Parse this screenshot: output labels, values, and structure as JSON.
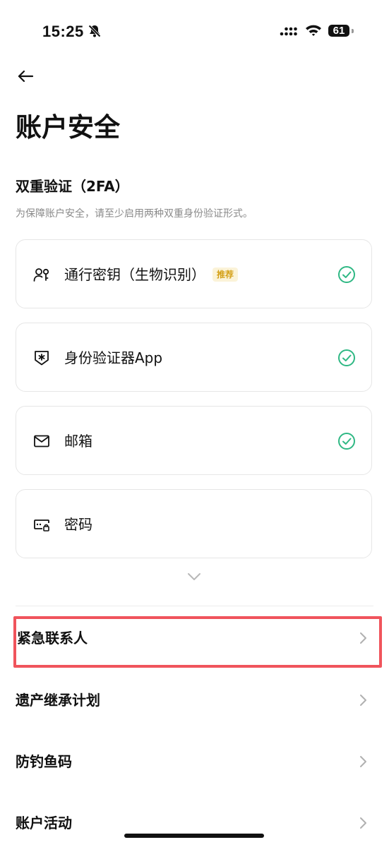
{
  "status_bar": {
    "time": "15:25",
    "battery": "61"
  },
  "page": {
    "title": "账户安全"
  },
  "two_fa": {
    "title": "双重验证（2FA）",
    "description": "为保障账户安全，请至少启用两种双重身份验证形式。",
    "methods": [
      {
        "label": "通行密钥（生物识别）",
        "tag": "推荐",
        "icon": "passkey-icon",
        "enabled": true
      },
      {
        "label": "身份验证器App",
        "icon": "authenticator-icon",
        "enabled": true
      },
      {
        "label": "邮箱",
        "icon": "mail-icon",
        "enabled": true
      },
      {
        "label": "密码",
        "icon": "password-icon",
        "enabled": false
      }
    ]
  },
  "menu": [
    {
      "label": "紧急联系人",
      "highlighted": true
    },
    {
      "label": "遗产继承计划"
    },
    {
      "label": "防钓鱼码"
    },
    {
      "label": "账户活动"
    }
  ],
  "colors": {
    "check": "#2fb884",
    "tag_text": "#d4a017",
    "tag_bg": "#fbf3d8",
    "highlight": "#f0545c"
  }
}
